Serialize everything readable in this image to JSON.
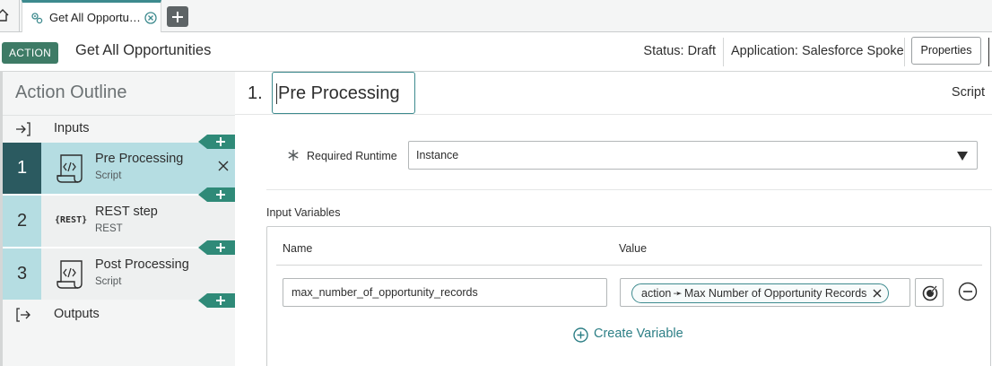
{
  "tabs": [
    {
      "label": "Get All Opportu…",
      "active": true
    }
  ],
  "header": {
    "badge": "ACTION",
    "title": "Get All Opportunities",
    "status": "Status: Draft",
    "application": "Application: Salesforce Spoke",
    "properties_label": "Properties"
  },
  "outline": {
    "title": "Action Outline",
    "inputs_label": "Inputs",
    "outputs_label": "Outputs",
    "steps": [
      {
        "num": "1",
        "name": "Pre Processing",
        "type": "Script",
        "icon": "script-icon",
        "active": true
      },
      {
        "num": "2",
        "name": "REST step",
        "type": "REST",
        "icon": "{REST}",
        "active": false
      },
      {
        "num": "3",
        "name": "Post Processing",
        "type": "Script",
        "icon": "script-icon",
        "active": false
      }
    ]
  },
  "main": {
    "step_index": "1.",
    "step_title": "Pre Processing",
    "step_type": "Script",
    "required_runtime_label": "Required Runtime",
    "required_runtime_value": "Instance",
    "input_variables_label": "Input Variables",
    "columns": {
      "name": "Name",
      "value": "Value"
    },
    "variables": [
      {
        "name": "max_number_of_opportunity_records",
        "pill_source": "action",
        "pill_field": "Max Number of Opportunity Records"
      }
    ],
    "create_variable_label": "Create Variable"
  },
  "colors": {
    "accent": "#3d8a8e",
    "badge": "#3e7b66",
    "step_active_bg": "#b5dde2",
    "step_num_active": "#2b5a60"
  }
}
